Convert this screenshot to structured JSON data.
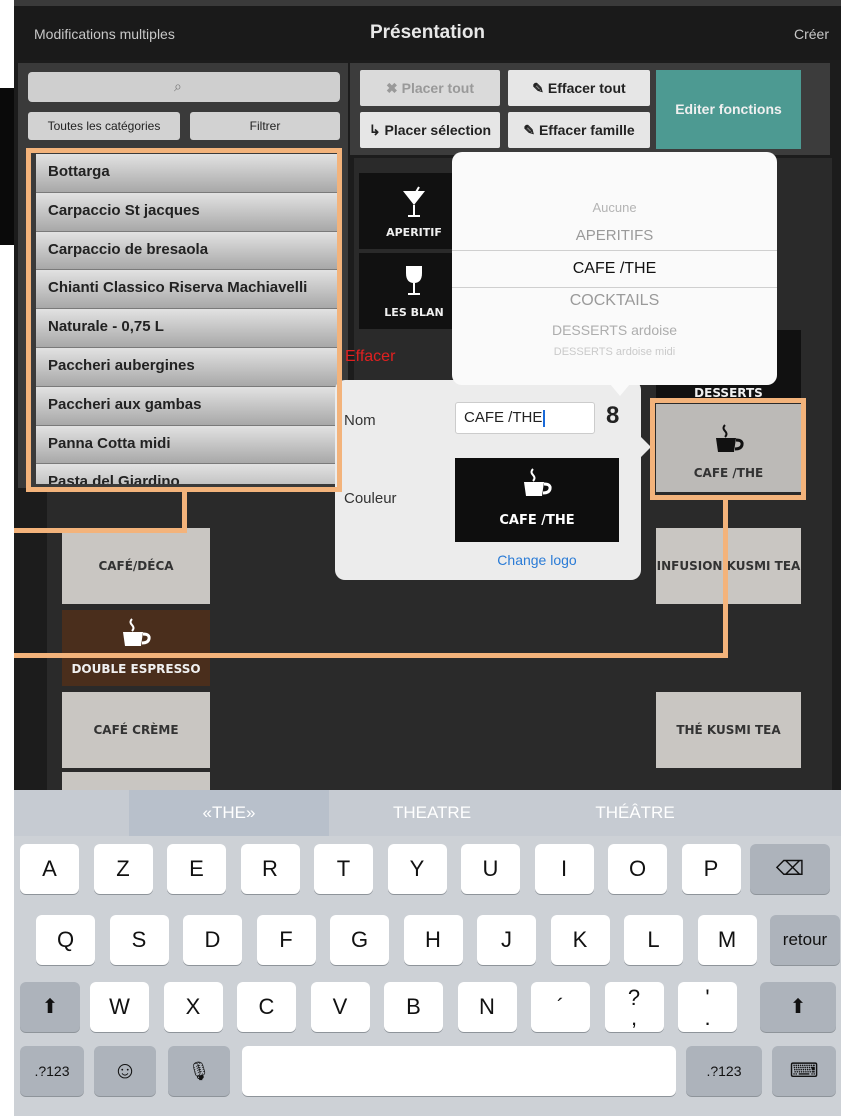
{
  "nav": {
    "left": "Modifications multiples",
    "title": "Présentation",
    "right": "Créer"
  },
  "left_panel": {
    "search_icon": "search-icon",
    "categories_button": "Toutes les catégories",
    "filter_button": "Filtrer",
    "items": [
      "Bottarga",
      "Carpaccio St jacques",
      "Carpaccio de bresaola",
      "Chianti Classico Riserva Machiavelli",
      "Naturale - 0,75 L",
      "Paccheri aubergines",
      "Paccheri aux gambas",
      "Panna Cotta midi",
      "Pasta del Giardino"
    ]
  },
  "toolbar": {
    "place_all": "Placer tout",
    "erase_all": "Effacer tout",
    "place_selection": "Placer sélection",
    "erase_family": "Effacer famille",
    "edit_functions": "Editer fonctions"
  },
  "board": {
    "tile_aperitifs": "APERITIF",
    "tile_blancs": "LES BLAN",
    "tile_desserts": "DESSERTS",
    "tile_cafe_the": "CAFE /THE",
    "tile_infusion": "INFUSION KUSMI TEA",
    "tile_the_kusmi": "THÉ KUSMI TEA",
    "tile_cafe_deca": "CAFÉ/DÉCA",
    "tile_double_espresso": "DOUBLE ESPRESSO",
    "tile_cafe_creme": "CAFÉ CRÈME"
  },
  "popover": {
    "erase": "Effacer",
    "name_label": "Nom",
    "name_value": "CAFE /THE",
    "link_icon": "link-icon",
    "color_label": "Couleur",
    "logo_label": "CAFE /THE",
    "change_logo": "Change logo"
  },
  "picker": {
    "options": [
      "Aucune",
      "APERITIFS",
      "CAFE /THE",
      "COCKTAILS",
      "DESSERTS ardoise",
      "DESSERTS ardoise midi"
    ],
    "selected": "CAFE /THE"
  },
  "keyboard": {
    "suggestions": [
      "«THE»",
      "THEATRE",
      "THÉÂTRE"
    ],
    "row1": [
      "A",
      "Z",
      "E",
      "R",
      "T",
      "Y",
      "U",
      "I",
      "O",
      "P"
    ],
    "row2": [
      "Q",
      "S",
      "D",
      "F",
      "G",
      "H",
      "J",
      "K",
      "L",
      "M"
    ],
    "row3": [
      "W",
      "X",
      "C",
      "V",
      "B",
      "N",
      "´",
      "?\n,",
      "'\n."
    ],
    "return": "retour",
    "numbers": ".?123",
    "numbers_right": ".?123"
  },
  "colors": {
    "accent_annotation": "#f3b37b",
    "edit_functions_bg": "#4d9a92",
    "erase_red": "#e02020",
    "link_blue": "#2a7bd6"
  }
}
